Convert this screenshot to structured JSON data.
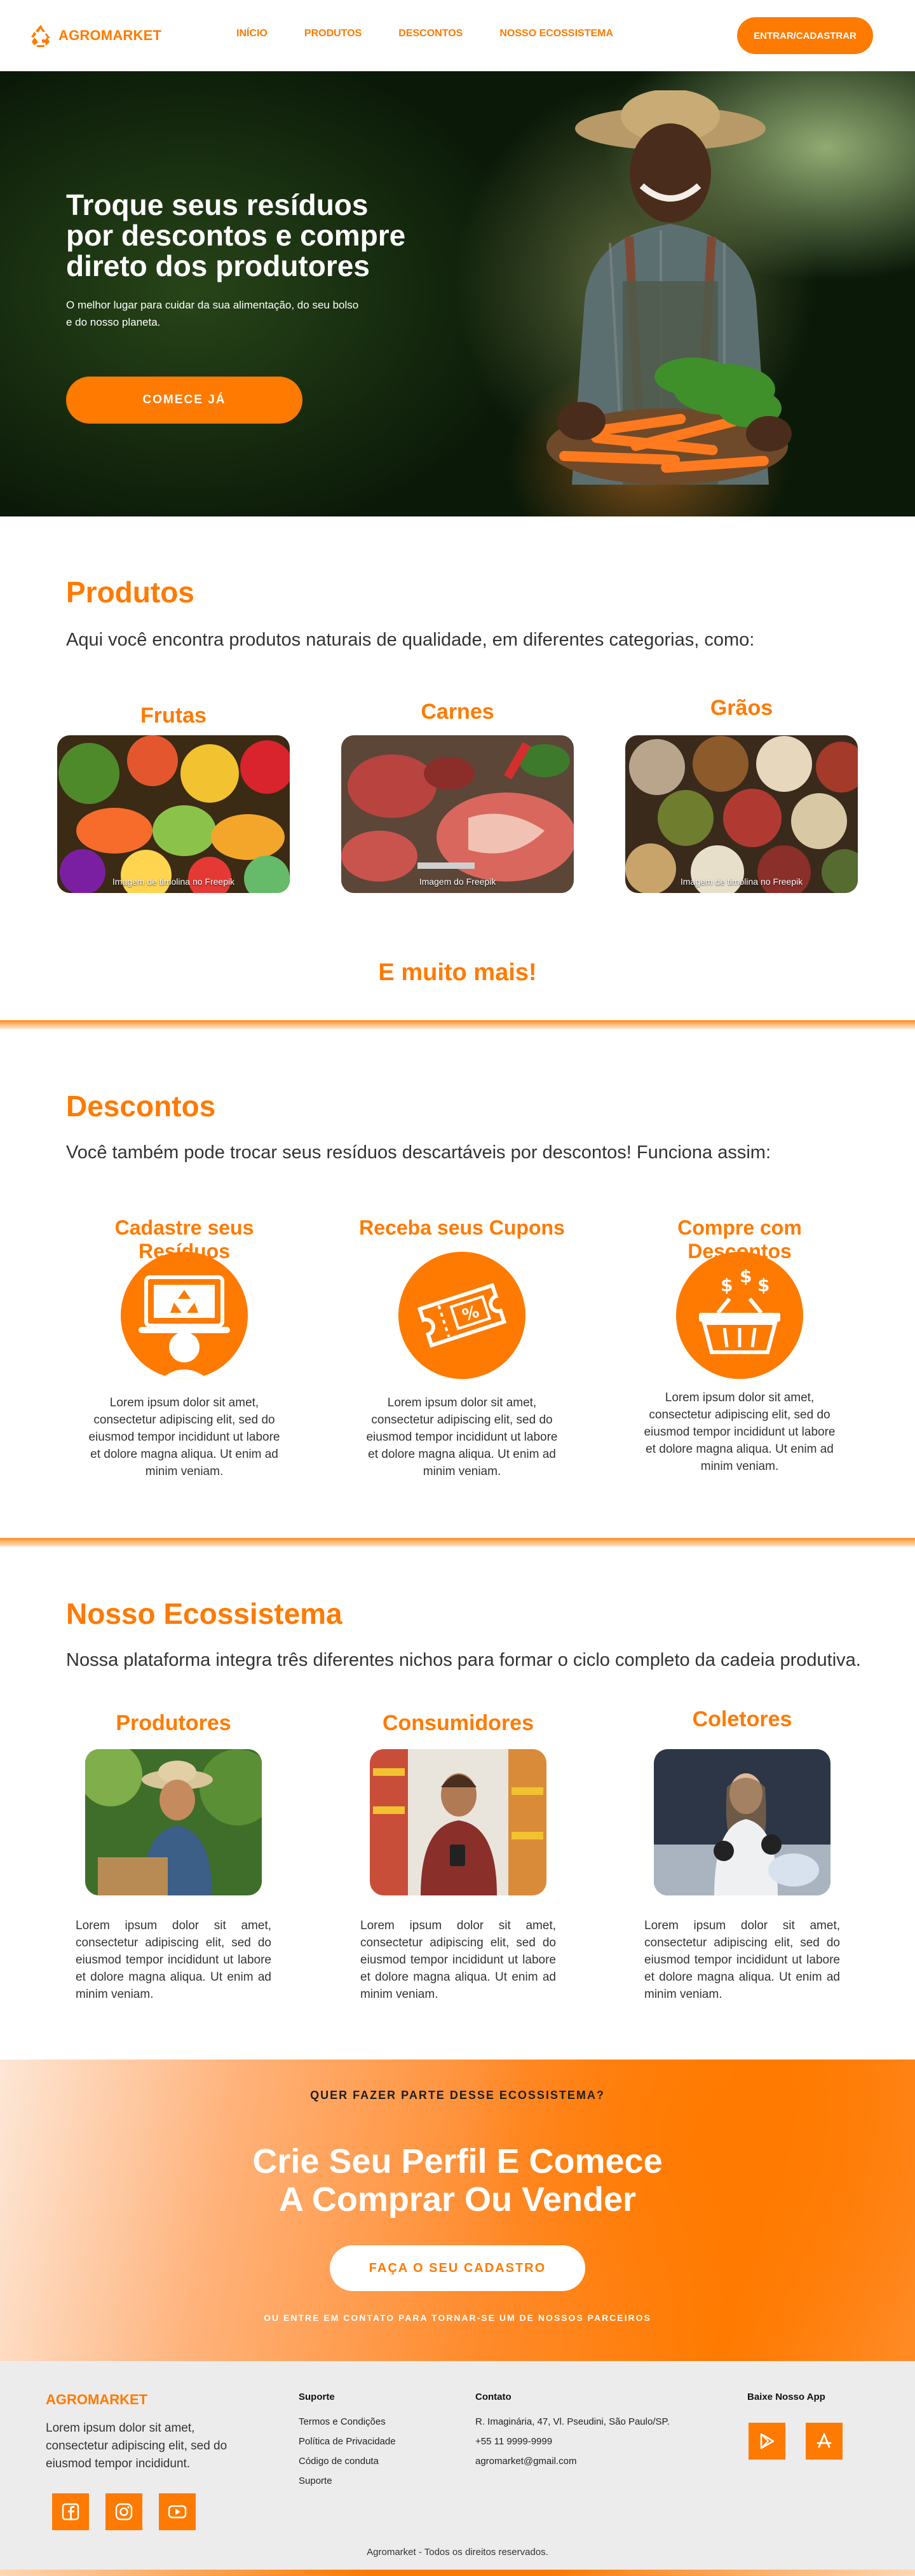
{
  "brand": {
    "name": "AGROMARKET",
    "accent": "#FF7A00"
  },
  "header": {
    "nav": [
      "INÍCIO",
      "PRODUTOS",
      "DESCONTOS",
      "NOSSO ECOSSISTEMA"
    ],
    "login_label": "ENTRAR/CADASTRAR"
  },
  "hero": {
    "title": "Troque seus resíduos por descontos e compre direto dos produtores",
    "subtitle": "O melhor lugar para cuidar da sua alimentação, do seu bolso e do nosso planeta.",
    "cta": "COMECE JÁ"
  },
  "products": {
    "title": "Produtos",
    "description": "Aqui você encontra produtos naturais de qualidade, em diferentes categorias, como:",
    "items": [
      {
        "title": "Frutas",
        "credit": "Imagem de timolina no Freepik"
      },
      {
        "title": "Carnes",
        "credit": "Imagem do Freepik"
      },
      {
        "title": "Grãos",
        "credit": "Imagem de timolina no Freepik"
      }
    ],
    "more": "E muito mais!"
  },
  "discounts": {
    "title": "Descontos",
    "description": "Você também pode trocar seus resíduos descartáveis por descontos! Funciona assim:",
    "steps": [
      {
        "title": "Cadastre seus Resíduos",
        "icon": "laptop-recycle-icon",
        "text": "Lorem ipsum dolor sit amet, consectetur adipiscing elit, sed do eiusmod tempor incididunt ut labore et dolore magna aliqua. Ut enim ad minim veniam."
      },
      {
        "title": "Receba seus Cupons",
        "icon": "coupon-percent-icon",
        "text": "Lorem ipsum dolor sit amet, consectetur adipiscing elit, sed do eiusmod tempor incididunt ut labore et dolore magna aliqua. Ut enim ad minim veniam."
      },
      {
        "title": "Compre com Descontos",
        "icon": "shopping-basket-dollar-icon",
        "text": "Lorem ipsum dolor sit amet, consectetur adipiscing elit, sed do eiusmod tempor incididunt ut labore et dolore magna aliqua. Ut enim ad minim veniam."
      }
    ]
  },
  "ecosystem": {
    "title": "Nosso Ecossistema",
    "description": "Nossa plataforma integra três diferentes nichos para formar o ciclo completo da cadeia produtiva.",
    "items": [
      {
        "title": "Produtores",
        "text": "Lorem ipsum dolor sit amet, consectetur adipiscing elit, sed do eiusmod tempor incididunt ut labore et dolore magna aliqua. Ut enim ad minim veniam."
      },
      {
        "title": "Consumidores",
        "text": "Lorem ipsum dolor sit amet, consectetur adipiscing elit, sed do eiusmod tempor incididunt ut labore et dolore magna aliqua. Ut enim ad minim veniam."
      },
      {
        "title": "Coletores",
        "text": "Lorem ipsum dolor sit amet, consectetur adipiscing elit, sed do eiusmod tempor incididunt ut labore et dolore magna aliqua. Ut enim ad minim veniam."
      }
    ]
  },
  "cta": {
    "kicker": "QUER FAZER PARTE DESSE ECOSSISTEMA?",
    "title_line1": "Crie Seu Perfil E Comece",
    "title_line2": "A Comprar Ou Vender",
    "button": "FAÇA O SEU CADASTRO",
    "note": "OU ENTRE EM CONTATO PARA TORNAR-SE UM DE NOSSOS PARCEIROS"
  },
  "footer": {
    "brand": "AGROMARKET",
    "about": "Lorem ipsum dolor sit amet, consectetur adipiscing elit, sed do eiusmod tempor incididunt.",
    "social": [
      "facebook-icon",
      "instagram-icon",
      "youtube-icon"
    ],
    "support": {
      "title": "Suporte",
      "links": [
        "Termos e Condições",
        "Política de Privacidade",
        "Código de conduta",
        "Suporte"
      ]
    },
    "contact": {
      "title": "Contato",
      "lines": [
        "R. Imaginária, 47, Vl. Pseudini, São Paulo/SP.",
        "+55 11 9999-9999",
        "agromarket@gmail.com"
      ]
    },
    "app": {
      "title": "Baixe Nosso App",
      "stores": [
        "google-play-icon",
        "app-store-icon"
      ]
    },
    "copyright": "Agromarket - Todos os direitos reservados."
  }
}
